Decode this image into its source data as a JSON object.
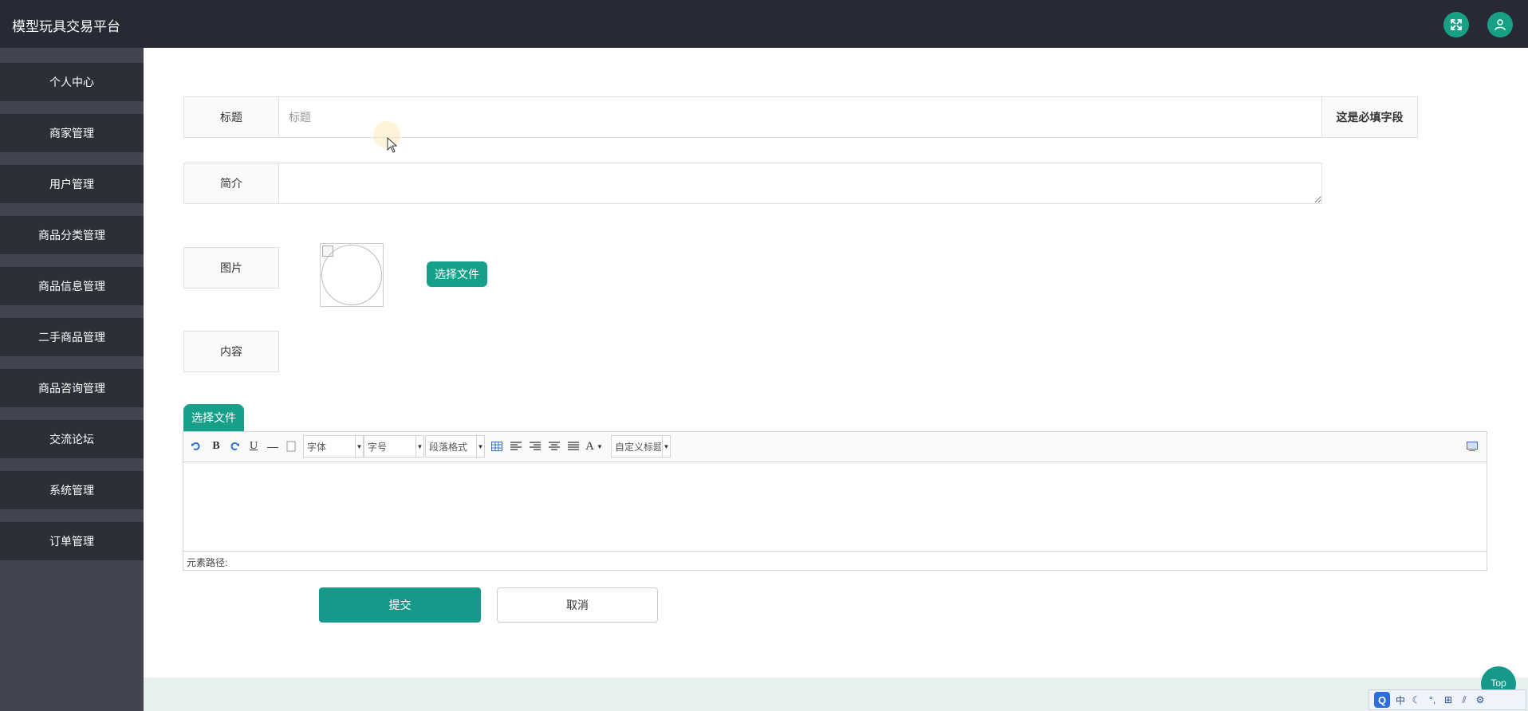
{
  "header": {
    "title": "模型玩具交易平台",
    "fullscreen_icon": "expand-icon",
    "user_icon": "user-icon",
    "accent_color": "#18a085"
  },
  "sidebar": {
    "items": [
      {
        "label": "个人中心"
      },
      {
        "label": "商家管理"
      },
      {
        "label": "用户管理"
      },
      {
        "label": "商品分类管理"
      },
      {
        "label": "商品信息管理"
      },
      {
        "label": "二手商品管理"
      },
      {
        "label": "商品咨询管理"
      },
      {
        "label": "交流论坛"
      },
      {
        "label": "系统管理"
      },
      {
        "label": "订单管理"
      }
    ]
  },
  "form": {
    "title_label": "标题",
    "title_placeholder": "标题",
    "title_value": "",
    "required_hint": "这是必填字段",
    "summary_label": "简介",
    "summary_value": "",
    "image_label": "图片",
    "image_choose_label": "选择文件",
    "content_label": "内容",
    "content_choose_label": "选择文件",
    "submit_label": "提交",
    "cancel_label": "取消"
  },
  "editor": {
    "toolbar": {
      "undo_icon": "undo-icon",
      "bold": "B",
      "redo_icon": "redo-icon",
      "underline": "U",
      "hr": "—",
      "page_icon": "page-icon",
      "font_family": "字体",
      "font_size": "字号",
      "paragraph": "段落格式",
      "table_icon": "table-icon",
      "align_left_icon": "align-left-icon",
      "align_right_icon": "align-right-icon",
      "align_center_icon": "align-center-icon",
      "justify_icon": "justify-icon",
      "font_color": "A",
      "custom_title": "自定义标题",
      "preview_icon": "preview-icon"
    },
    "status": "元素路径:"
  },
  "misc": {
    "top_button": "Top"
  },
  "ime_bar": {
    "items": [
      "中",
      "°,",
      "⊞",
      "⚙"
    ]
  }
}
